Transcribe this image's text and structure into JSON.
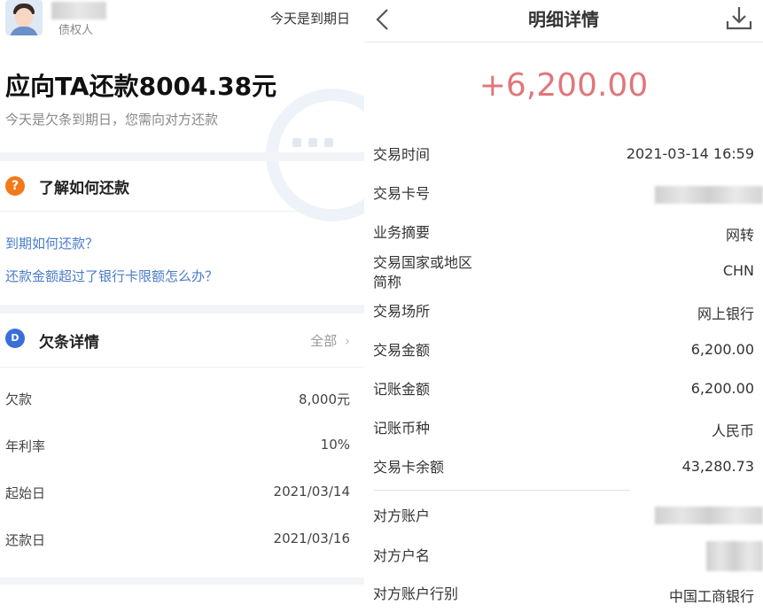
{
  "left": {
    "header": {
      "creditor_label": "债权人",
      "due_today": "今天是到期日"
    },
    "hero": {
      "title": "应向TA还款8004.38元",
      "subtitle": "今天是欠条到期日，您需向对方还款"
    },
    "howto": {
      "icon_glyph": "?",
      "title": "了解如何还款",
      "links": [
        "到期如何还款？",
        "还款金额超过了银行卡限额怎么办？"
      ]
    },
    "iou": {
      "icon_glyph": "D",
      "title": "欠条详情",
      "all_label": "全部",
      "all_chevron": "›",
      "rows": [
        {
          "label": "欠款",
          "value": "8,000元"
        },
        {
          "label": "年利率",
          "value": "10%"
        },
        {
          "label": "起始日",
          "value": "2021/03/14"
        },
        {
          "label": "还款日",
          "value": "2021/03/16"
        }
      ]
    }
  },
  "right": {
    "nav": {
      "title": "明细详情",
      "back_icon": "chevron-left-icon",
      "download_icon": "download-icon"
    },
    "amount": "+6,200.00",
    "amount_color": "#e0777b",
    "rows": [
      {
        "label": "交易时间",
        "value": "2021-03-14 16:59"
      },
      {
        "label": "交易卡号",
        "value": ""
      },
      {
        "label": "业务摘要",
        "value": "网转"
      },
      {
        "label": "交易国家或地区",
        "label2": "简称",
        "value": "CHN"
      },
      {
        "label": "交易场所",
        "value": "网上银行"
      },
      {
        "label": "交易金额",
        "value": "6,200.00"
      },
      {
        "label": "记账金额",
        "value": "6,200.00"
      },
      {
        "label": "记账币种",
        "value": "人民币"
      },
      {
        "label": "交易卡余额",
        "value": "43,280.73"
      },
      {
        "label": "对方账户",
        "value": ""
      },
      {
        "label": "对方户名",
        "value": ""
      },
      {
        "label": "对方账户行别",
        "value": "中国工商银行"
      }
    ]
  }
}
